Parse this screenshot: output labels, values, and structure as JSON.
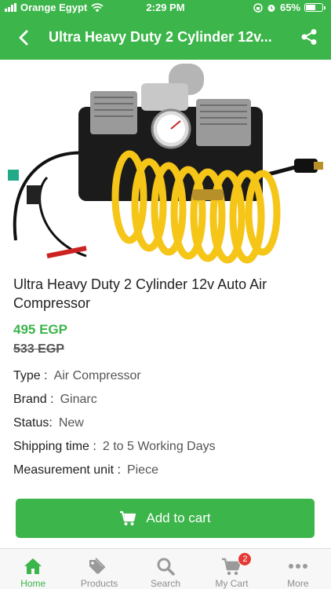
{
  "status_bar": {
    "carrier": "Orange Egypt",
    "time": "2:29 PM",
    "battery": "65%",
    "battery_level": 0.65
  },
  "header": {
    "title": "Ultra Heavy Duty 2 Cylinder 12v...",
    "back_icon": "chevron-left-icon",
    "share_icon": "share-icon",
    "color": "#3cb54a"
  },
  "product": {
    "name": "Ultra Heavy Duty 2 Cylinder 12v Auto Air Compressor",
    "price": "495 EGP",
    "old_price": "533 EGP",
    "attributes": [
      {
        "key": "Type :",
        "value": "Air Compressor"
      },
      {
        "key": "Brand :",
        "value": "Ginarc"
      },
      {
        "key": "Status:",
        "value": "New"
      },
      {
        "key": "Shipping time :",
        "value": "2 to 5  Working Days"
      },
      {
        "key": "Measurement unit :",
        "value": "Piece"
      }
    ]
  },
  "actions": {
    "add_to_cart": "Add to cart"
  },
  "tabbar": {
    "items": [
      {
        "label": "Home",
        "icon": "home-icon",
        "active": true
      },
      {
        "label": "Products",
        "icon": "tag-icon",
        "active": false
      },
      {
        "label": "Search",
        "icon": "search-icon",
        "active": false
      },
      {
        "label": "My Cart",
        "icon": "cart-icon",
        "active": false,
        "badge": "2"
      },
      {
        "label": "More",
        "icon": "more-icon",
        "active": false
      }
    ]
  }
}
